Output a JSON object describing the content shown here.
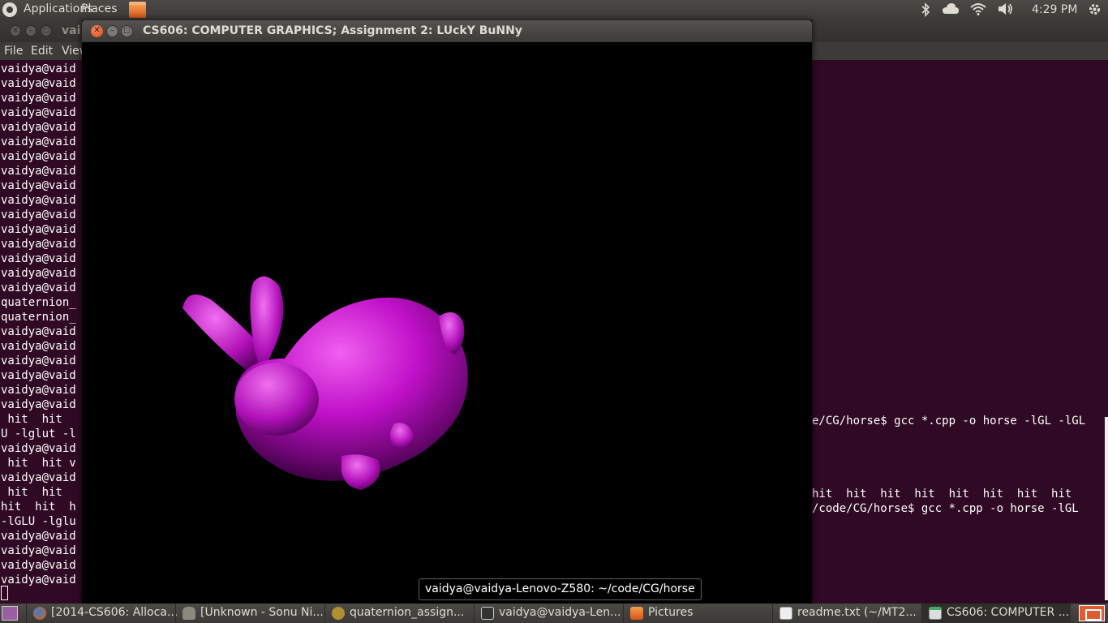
{
  "top_panel": {
    "applications": "Applications",
    "places": "Places",
    "time": "4:29 PM",
    "tray_icons": [
      "bluetooth-icon",
      "cloud-icon",
      "wifi-icon",
      "volume-icon",
      "gear-icon"
    ]
  },
  "terminal": {
    "title_partial": "vai",
    "menu": [
      "File",
      "Edit",
      "View"
    ],
    "left_lines": [
      "vaidya@vaid",
      "vaidya@vaid",
      "vaidya@vaid",
      "vaidya@vaid",
      "vaidya@vaid",
      "vaidya@vaid",
      "vaidya@vaid",
      "vaidya@vaid",
      "vaidya@vaid",
      "vaidya@vaid",
      "vaidya@vaid",
      "vaidya@vaid",
      "vaidya@vaid",
      "vaidya@vaid",
      "vaidya@vaid",
      "vaidya@vaid",
      "quaternion_",
      "quaternion_",
      "vaidya@vaid",
      "vaidya@vaid",
      "vaidya@vaid",
      "vaidya@vaid",
      "vaidya@vaid",
      "vaidya@vaid",
      " hit  hit ",
      "U -lglut -l",
      "vaidya@vaid",
      " hit  hit v",
      "vaidya@vaid",
      " hit  hit ",
      "hit  hit  h",
      "-lGLU -lglu",
      "vaidya@vaid",
      "vaidya@vaid",
      "vaidya@vaid",
      "vaidya@vaid"
    ],
    "right_line_1": "e/CG/horse$ gcc *.cpp -o horse -lGL -lGL",
    "right_line_2": "hit  hit  hit  hit  hit  hit  hit  hit",
    "right_line_3": "/code/CG/horse$ gcc *.cpp -o horse -lGL"
  },
  "gl_window": {
    "title": "CS606: COMPUTER GRAPHICS; Assignment 2: LUckY BuNNy",
    "bunny_color": "#cc11cc"
  },
  "tooltip": "vaidya@vaidya-Lenovo-Z580: ~/code/CG/horse",
  "taskbar": [
    {
      "label": "[2014-CS606: Alloca...",
      "icon": "firefox-icon",
      "color": "#e66000"
    },
    {
      "label": "[Unknown - Sonu Ni...",
      "icon": "media-player-icon",
      "color": "#8a8a80"
    },
    {
      "label": "quaternion_assign...",
      "icon": "gimp-icon",
      "color": "#b09030"
    },
    {
      "label": "vaidya@vaidya-Len...",
      "icon": "terminal-icon",
      "color": "#333333"
    },
    {
      "label": "Pictures",
      "icon": "folder-icon",
      "color": "#d8531c"
    },
    {
      "label": "readme.txt (~/MT2...",
      "icon": "text-editor-icon",
      "color": "#eeeeee"
    },
    {
      "label": "CS606: COMPUTER ...",
      "icon": "window-icon",
      "color": "#dddddd"
    }
  ]
}
